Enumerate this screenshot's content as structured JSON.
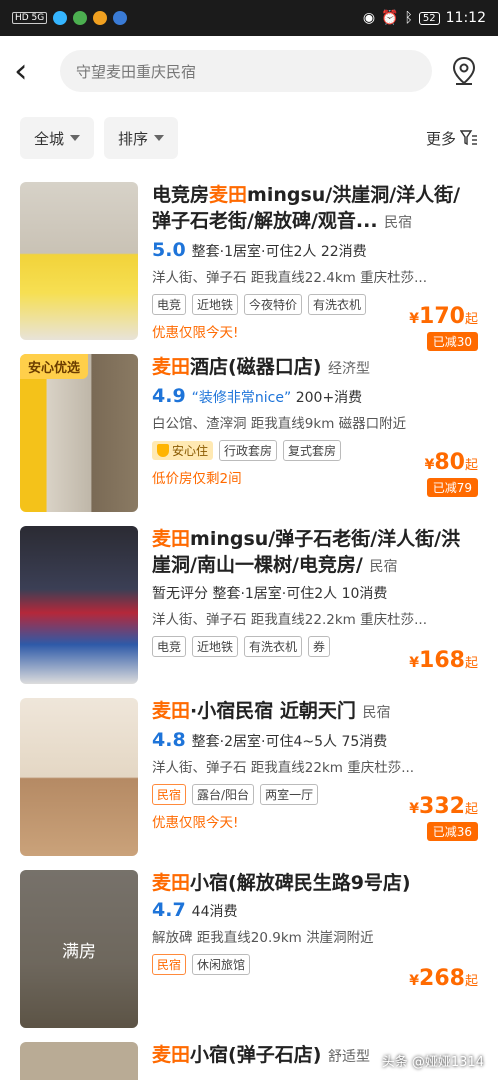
{
  "status": {
    "network": "HD 5G",
    "battery": "52",
    "time": "11:12"
  },
  "search": {
    "text": "守望麦田重庆民宿"
  },
  "filters": {
    "city": "全城",
    "sort": "排序",
    "more": "更多"
  },
  "listings": [
    {
      "title_hl": "麦田",
      "title_pre": "电竞房",
      "title_post": "mingsu/洪崖洞/洋人街/弹子石老街/解放碑/观音...",
      "type": "民宿",
      "score": "5.0",
      "meta": "整套·1居室·可住2人 22消费",
      "location": "洋人街、弹子石 距我直线22.4km 重庆杜莎...",
      "badges": [
        "电竞",
        "近地铁",
        "今夜特价",
        "有洗衣机"
      ],
      "price": "170",
      "unit": "起",
      "promo": "优惠仅限今天!",
      "reduce": "已减30"
    },
    {
      "title_hl": "麦田",
      "title_pre": "",
      "title_post": "酒店(磁器口店)",
      "type": "经济型",
      "score": "4.9",
      "quote": "“装修非常nice”",
      "meta": "200+消费",
      "location": "白公馆、渣滓洞 距我直线9km 磁器口附近",
      "anxin_label": "安心住",
      "badges": [
        "行政套房",
        "复式套房"
      ],
      "price": "80",
      "unit": "起",
      "promo": "低价房仅剩2间",
      "reduce": "已减79",
      "top_tag": "安心优选"
    },
    {
      "title_hl": "麦田",
      "title_pre": "",
      "title_post": "mingsu/弹子石老街/洋人街/洪崖洞/南山一棵树/电竞房/",
      "type": "民宿",
      "score_text": "暂无评分",
      "meta": "整套·1居室·可住2人 10消费",
      "location": "洋人街、弹子石 距我直线22.2km 重庆杜莎...",
      "badges": [
        "电竞",
        "近地铁",
        "有洗衣机",
        "券"
      ],
      "price": "168",
      "unit": "起"
    },
    {
      "title_hl": "麦田",
      "title_pre": "",
      "title_post": "·小宿民宿 近朝天门",
      "type": "民宿",
      "score": "4.8",
      "meta": "整套·2居室·可住4~5人 75消费",
      "location": "洋人街、弹子石 距我直线22km 重庆杜莎...",
      "badges": [
        "民宿",
        "露台/阳台",
        "两室一厅"
      ],
      "price": "332",
      "unit": "起",
      "promo": "优惠仅限今天!",
      "reduce": "已减36"
    },
    {
      "title_hl": "麦田",
      "title_pre": "",
      "title_post": "小宿(解放碑民生路9号店)",
      "type": "",
      "score": "4.7",
      "meta": "44消费",
      "location": "解放碑 距我直线20.9km 洪崖洞附近",
      "badges": [
        "民宿",
        "休闲旅馆"
      ],
      "price": "268",
      "unit": "起",
      "full_label": "满房"
    },
    {
      "title_hl": "麦田",
      "title_pre": "",
      "title_post": "小宿(弹子石店)",
      "type": "舒适型"
    }
  ],
  "watermark": "头条 @娅娅1314",
  "colors": {
    "accent": "#ff6a00",
    "score": "#1e74d9"
  }
}
